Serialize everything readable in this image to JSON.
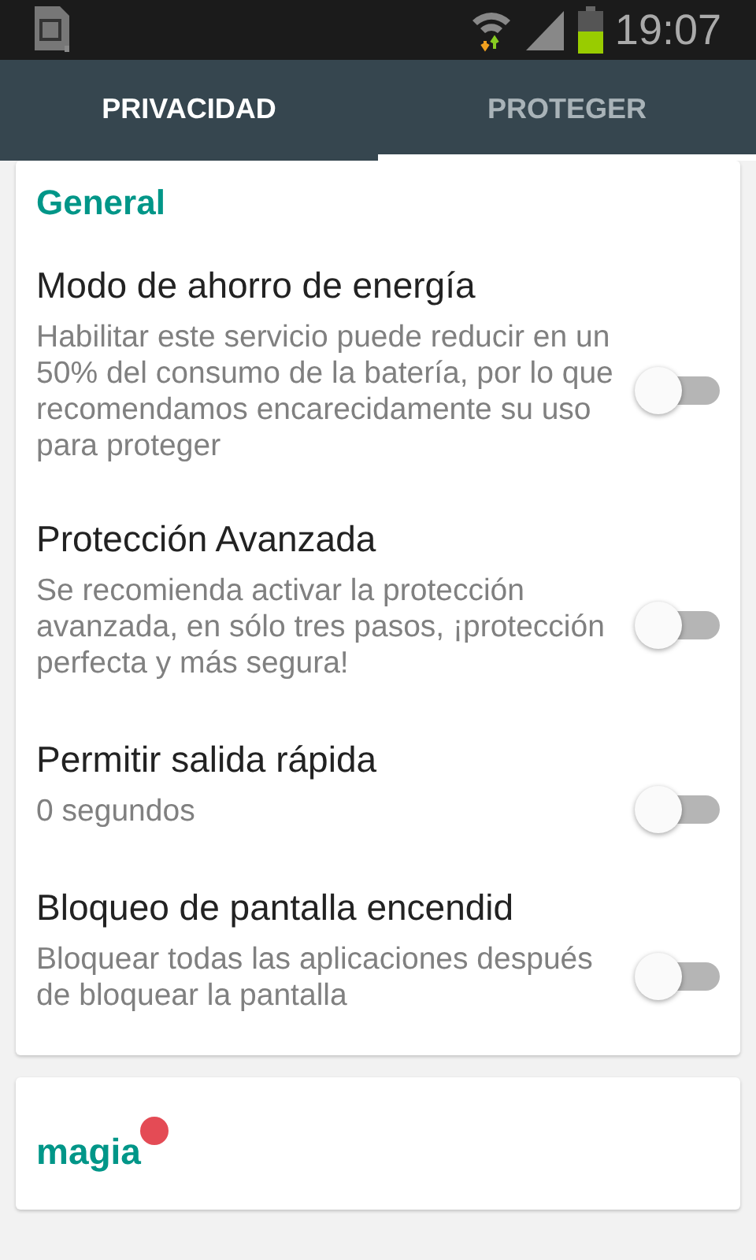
{
  "status_bar": {
    "time": "19:07"
  },
  "tabs": [
    {
      "label": "PRIVACIDAD",
      "selected": false,
      "bright": true
    },
    {
      "label": "PROTEGER",
      "selected": true,
      "bright": false
    }
  ],
  "section": {
    "title": "General"
  },
  "settings": [
    {
      "title": "Modo de ahorro de energía",
      "description": "Habilitar este servicio puede reducir en un 50% del consumo de la batería, por lo que recomendamos encarecidamente su uso para proteger",
      "on": false
    },
    {
      "title": "Protección Avanzada",
      "description": "Se recomienda activar la protección avanzada, en sólo tres pasos, ¡protección perfecta y más segura!",
      "on": false
    },
    {
      "title": "Permitir salida rápida",
      "description": "0 segundos",
      "on": false
    },
    {
      "title": "Bloqueo de pantalla encendid",
      "description": "Bloquear todas las aplicaciones después de bloquear la pantalla",
      "on": false
    }
  ],
  "magic_card": {
    "title": "magia",
    "color": "#e44b55"
  }
}
